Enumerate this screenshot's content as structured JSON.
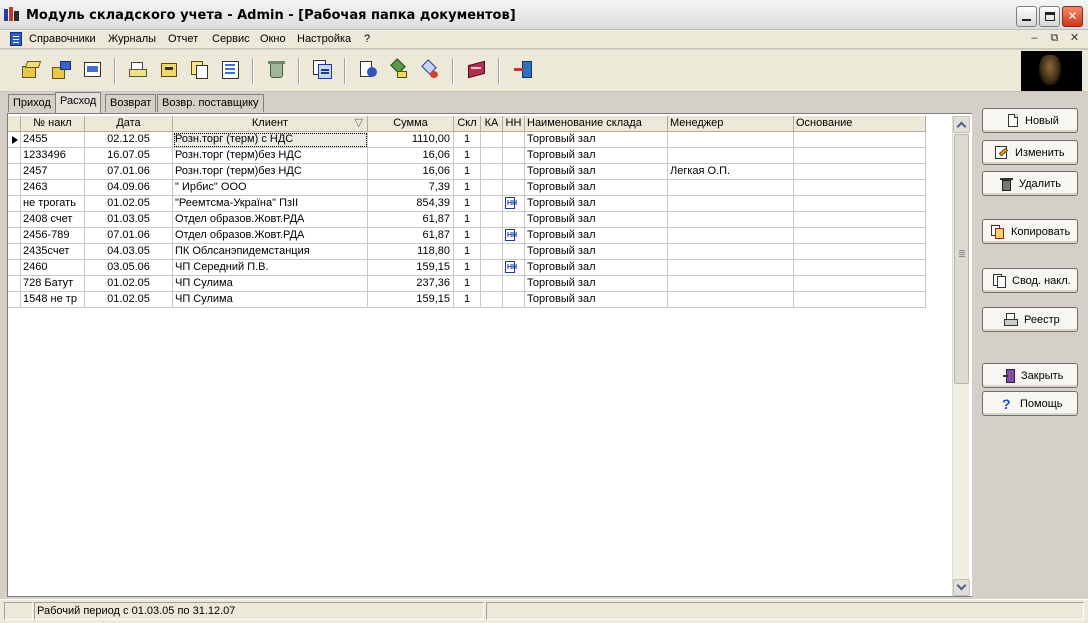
{
  "window": {
    "title": "Модуль складского учета - Admin - [Рабочая папка документов]",
    "min_glyph": "",
    "max_glyph": "",
    "close_glyph": "✕"
  },
  "menu": {
    "items": [
      "Справочники",
      "Журналы",
      "Отчет",
      "Сервис",
      "Окно",
      "Настройка",
      "?"
    ],
    "mdi_min": "–",
    "mdi_restore": "⧉",
    "mdi_close": "✕"
  },
  "tabs": [
    {
      "label": "Приход",
      "active": false
    },
    {
      "label": "Расход",
      "active": true
    },
    {
      "label": "Возврат",
      "active": false
    },
    {
      "label": "Возвр. поставщику",
      "active": false
    }
  ],
  "grid": {
    "columns": [
      "№ накл",
      "Дата",
      "Клиент",
      "Сумма",
      "Скл",
      "КА",
      "НН",
      "Наименование склада",
      "Менеджер",
      "Основание"
    ],
    "sort_glyph": "▽",
    "nn_icon_text": "НН",
    "rows": [
      {
        "num": "2455",
        "date": "02.12.05",
        "client": " Розн.торг (терм) с НДС",
        "sum": "1110,00",
        "skl": "1",
        "ka": "",
        "nn": false,
        "warehouse": "Торговый зал",
        "manager": "",
        "basis": "",
        "current": true
      },
      {
        "num": "1233496",
        "date": "16.07.05",
        "client": " Розн.торг (терм)без НДС",
        "sum": "16,06",
        "skl": "1",
        "ka": "",
        "nn": false,
        "warehouse": "Торговый зал",
        "manager": "",
        "basis": "",
        "current": false
      },
      {
        "num": "2457",
        "date": "07.01.06",
        "client": " Розн.торг (терм)без НДС",
        "sum": "16,06",
        "skl": "1",
        "ka": "",
        "nn": false,
        "warehouse": "Торговый зал",
        "manager": "Легкая О.П.",
        "basis": "",
        "current": false
      },
      {
        "num": "2463",
        "date": "04.09.06",
        "client": " \" Ирбис\" ООО",
        "sum": "7,39",
        "skl": "1",
        "ka": "",
        "nn": false,
        "warehouse": "Торговый зал",
        "manager": "",
        "basis": "",
        "current": false
      },
      {
        "num": "не трогать",
        "date": "01.02.05",
        "client": "\"Реемтсма-Україна\" ПзІІ",
        "sum": "854,39",
        "skl": "1",
        "ka": "",
        "nn": true,
        "warehouse": "Торговый зал",
        "manager": "",
        "basis": "",
        "current": false
      },
      {
        "num": "2408 счет",
        "date": "01.03.05",
        "client": "Отдел образов.Жовт.РДА",
        "sum": "61,87",
        "skl": "1",
        "ka": "",
        "nn": false,
        "warehouse": "Торговый зал",
        "manager": "",
        "basis": "",
        "current": false
      },
      {
        "num": "2456-789",
        "date": "07.01.06",
        "client": "Отдел образов.Жовт.РДА",
        "sum": "61,87",
        "skl": "1",
        "ka": "",
        "nn": true,
        "warehouse": "Торговый зал",
        "manager": "",
        "basis": "",
        "current": false
      },
      {
        "num": "2435счет",
        "date": "04.03.05",
        "client": "ПК Облсанэпидемстанция",
        "sum": "118,80",
        "skl": "1",
        "ka": "",
        "nn": false,
        "warehouse": "Торговый зал",
        "manager": "",
        "basis": "",
        "current": false
      },
      {
        "num": "2460",
        "date": "03.05.06",
        "client": "ЧП Середний П.В.",
        "sum": "159,15",
        "skl": "1",
        "ka": "",
        "nn": true,
        "warehouse": "Торговый зал",
        "manager": "",
        "basis": "",
        "current": false
      },
      {
        "num": "728 Батут",
        "date": "01.02.05",
        "client": "ЧП Сулима",
        "sum": "237,36",
        "skl": "1",
        "ka": "",
        "nn": false,
        "warehouse": "Торговый зал",
        "manager": "",
        "basis": "",
        "current": false
      },
      {
        "num": "1548 не тр",
        "date": "01.02.05",
        "client": "ЧП Сулима",
        "sum": "159,15",
        "skl": "1",
        "ka": "",
        "nn": false,
        "warehouse": "Торговый зал",
        "manager": "",
        "basis": "",
        "current": false
      }
    ]
  },
  "buttons": {
    "new": "Новый",
    "edit": "Изменить",
    "delete": "Удалить",
    "copy": "Копировать",
    "summary": "Свод. накл.",
    "registry": "Реестр",
    "close": "Закрыть",
    "help": "Помощь"
  },
  "status": {
    "period": "Рабочий период с 01.03.05 по 31.12.07"
  },
  "colors": {
    "grid_bg": "#ffffff",
    "header_bg": "#ece9d8",
    "chrome_bg": "#ece9d8",
    "accent_blue": "#1a3a9a"
  }
}
